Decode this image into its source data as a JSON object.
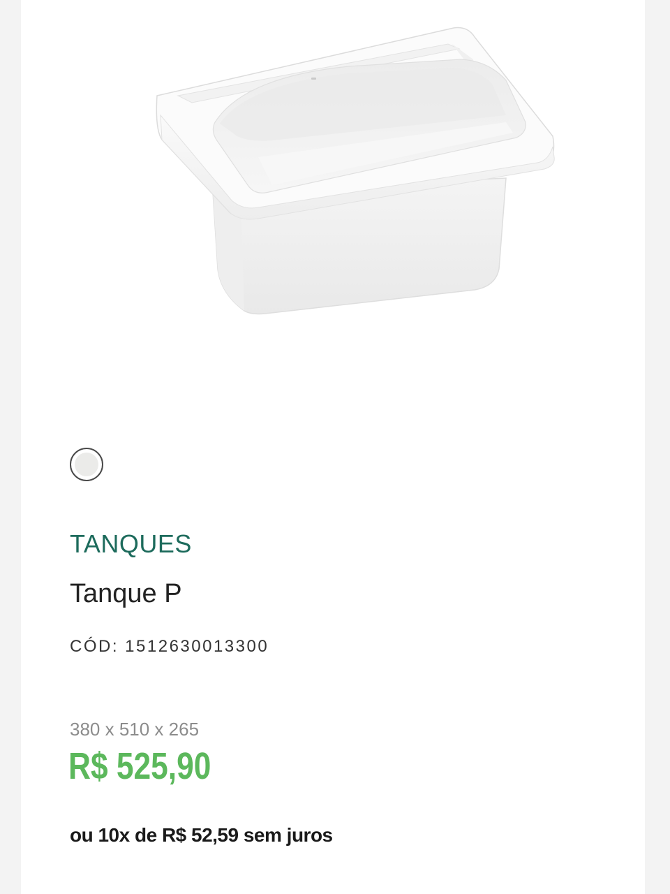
{
  "product": {
    "image_alt": "Tanque P",
    "category": "TANQUES",
    "name": "Tanque P",
    "code_label": "CÓD:",
    "code": "1512630013300",
    "dimensions": "380 x 510 x 265",
    "price": "R$ 525,90",
    "installments": "ou 10x de R$ 52,59 sem juros"
  },
  "variants": [
    {
      "color": "#ebebe9",
      "selected": true
    }
  ],
  "colors": {
    "category": "#1d6b5c",
    "price": "#5cb85c",
    "background": "#f3f3f3"
  }
}
